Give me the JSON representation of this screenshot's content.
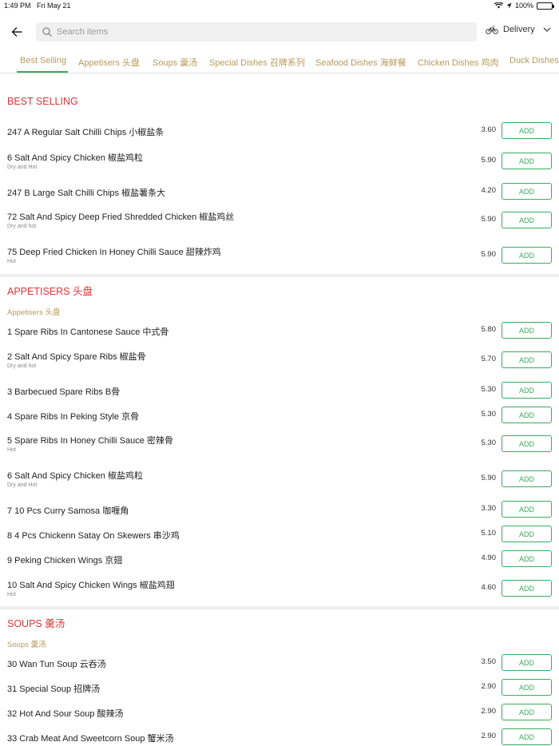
{
  "status_bar": {
    "time": "1:49 PM",
    "date": "Fri May 21",
    "battery": "100%"
  },
  "header": {
    "search_placeholder": "Search items",
    "delivery_label": "Delivery"
  },
  "tabs": [
    {
      "label": "Best Selling"
    },
    {
      "label": "Appetisers 头盘"
    },
    {
      "label": "Soups 羹汤"
    },
    {
      "label": "Special Dishes 召牌系列"
    },
    {
      "label": "Seafood Dishes 海鲜餐"
    },
    {
      "label": "Chicken Dishes 鸡肉"
    },
    {
      "label": "Duck Dishes"
    }
  ],
  "add_label": "ADD",
  "sections": [
    {
      "title": "BEST SELLING",
      "subtitle": "",
      "items": [
        {
          "name": "247 A Regular Salt Chilli Chips 小椒盐条",
          "desc": "",
          "price": "3.60"
        },
        {
          "name": "6 Salt And Spicy Chicken 椒盐鸡粒",
          "desc": "Dry and Hot",
          "price": "5.90"
        },
        {
          "name": "247 B Large Salt Chilli Chips 椒盐薯条大",
          "desc": "",
          "price": "4.20"
        },
        {
          "name": "72 Salt And Spicy Deep Fried Shredded Chicken 椒盐鸡丝",
          "desc": "Dry and hot",
          "price": "5.90"
        },
        {
          "name": "75 Deep Fried Chicken In Honey Chilli Sauce 甜辣炸鸡",
          "desc": "Hot",
          "price": "5.90"
        }
      ]
    },
    {
      "title": "APPETISERS 头盘",
      "subtitle": "Appetisers 头盘",
      "items": [
        {
          "name": "1 Spare Ribs In Cantonese Sauce 中式骨",
          "desc": "",
          "price": "5.80"
        },
        {
          "name": "2 Salt And Spicy Spare Ribs 椒盐骨",
          "desc": "Dry and hot",
          "price": "5.70"
        },
        {
          "name": "3 Barbecued Spare Ribs B骨",
          "desc": "",
          "price": "5.30"
        },
        {
          "name": "4 Spare Ribs In Peking Style 京骨",
          "desc": "",
          "price": "5.30"
        },
        {
          "name": "5 Spare Ribs In Honey Chilli Sauce 密辣骨",
          "desc": "Hot",
          "price": "5.30"
        },
        {
          "name": "6 Salt And Spicy Chicken 椒盐鸡粒",
          "desc": "Dry and Hot",
          "price": "5.90"
        },
        {
          "name": "7 10 Pcs Curry Samosa 咖喱角",
          "desc": "",
          "price": "3.30"
        },
        {
          "name": "8 4 Pcs Chickenn Satay On Skewers 串沙鸡",
          "desc": "",
          "price": "5.10"
        },
        {
          "name": "9 Peking Chicken Wings 京翅",
          "desc": "",
          "price": "4.90"
        },
        {
          "name": "10 Salt And Spicy Chicken Wings 椒盐鸡翅",
          "desc": "Hot",
          "price": "4.60"
        }
      ]
    },
    {
      "title": "SOUPS 羹汤",
      "subtitle": "Soups 羹汤",
      "items": [
        {
          "name": "30 Wan Tun Soup 云吞汤",
          "desc": "",
          "price": "3.50"
        },
        {
          "name": "31 Special Soup 招牌汤",
          "desc": "",
          "price": "2.90"
        },
        {
          "name": "32 Hot And Sour Soup 酸辣汤",
          "desc": "",
          "price": "2.90"
        },
        {
          "name": "33 Crab Meat And Sweetcorn Soup 蟹米汤",
          "desc": "",
          "price": "2.90"
        }
      ]
    }
  ]
}
